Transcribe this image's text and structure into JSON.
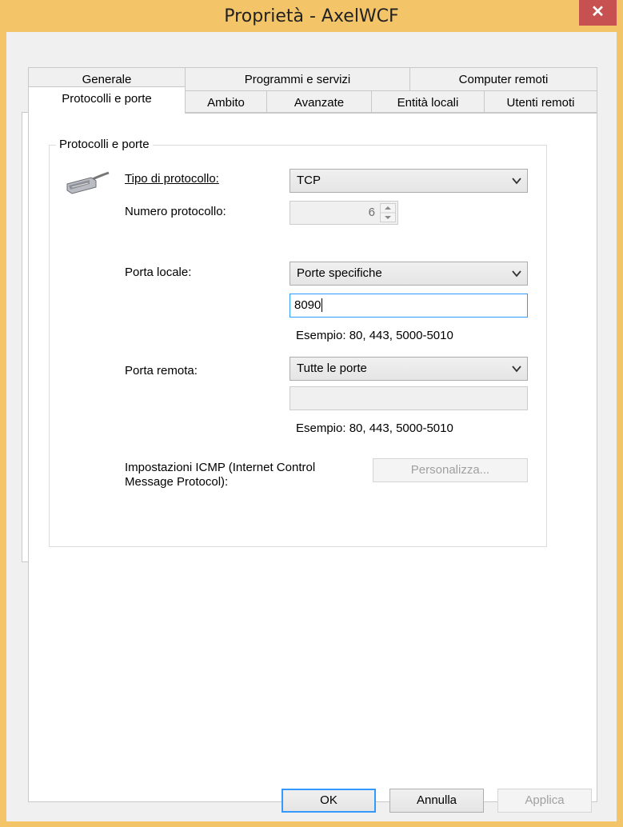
{
  "window": {
    "title": "Proprietà - AxelWCF",
    "close_label": "✕"
  },
  "tabs": {
    "row1": [
      {
        "label": "Generale"
      },
      {
        "label": "Programmi e servizi"
      },
      {
        "label": "Computer remoti"
      }
    ],
    "row2": [
      {
        "label": "Protocolli e porte"
      },
      {
        "label": "Ambito"
      },
      {
        "label": "Avanzate"
      },
      {
        "label": "Entità locali"
      },
      {
        "label": "Utenti remoti"
      }
    ]
  },
  "group": {
    "title": "Protocolli e porte",
    "protocol_type": {
      "label": "Tipo di protocollo:",
      "value": "TCP"
    },
    "protocol_number": {
      "label": "Numero protocollo:",
      "value": "6"
    },
    "local_port": {
      "label": "Porta locale:",
      "mode": "Porte specifiche",
      "value": "8090",
      "example": "Esempio: 80, 443, 5000-5010"
    },
    "remote_port": {
      "label": "Porta remota:",
      "mode": "Tutte le porte",
      "value": "",
      "example": "Esempio: 80, 443, 5000-5010"
    },
    "icmp": {
      "label_line1": "Impostazioni ICMP (Internet Control",
      "label_line2": "Message Protocol):",
      "button": "Personalizza..."
    }
  },
  "footer": {
    "ok": "OK",
    "cancel": "Annulla",
    "apply": "Applica"
  }
}
